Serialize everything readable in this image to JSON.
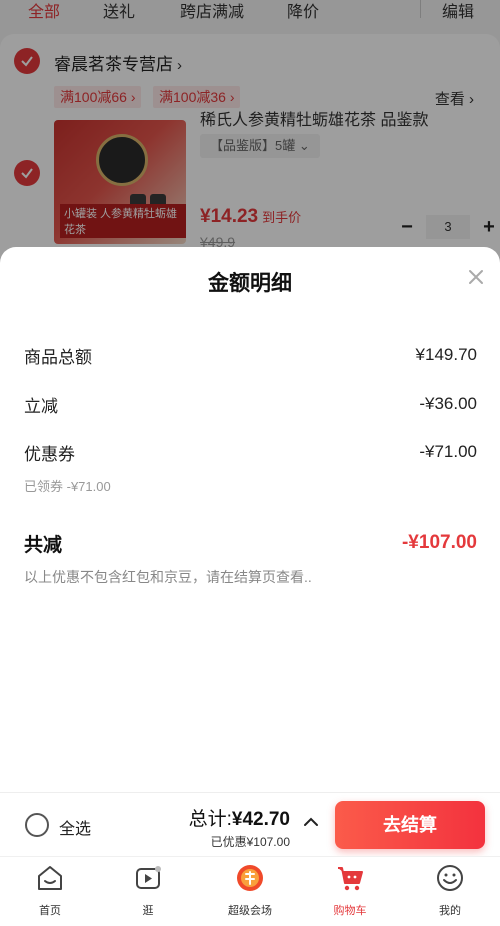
{
  "tabs": [
    {
      "label": "全部",
      "active": true
    },
    {
      "label": "送礼",
      "active": false
    },
    {
      "label": "跨店满减",
      "active": false
    },
    {
      "label": "降价",
      "active": false
    },
    {
      "label": "编辑",
      "active": false
    }
  ],
  "store": {
    "name": "睿晨茗茶专营店",
    "arrow": "›",
    "promos": [
      "满100减66 ›",
      "满100减36 ›"
    ],
    "view_label": "查看 ›"
  },
  "product": {
    "title": "稀氏人参黄精牡蛎雄花茶 品鉴款",
    "image_label": "小罐装 人参黄精牡蛎雄花茶",
    "variant": "【品鉴版】5罐  ⌄",
    "price_symbol": "¥",
    "price": "14.23",
    "price_hint": "到手价",
    "old_price": "¥49.9",
    "quantity": "3",
    "minus": "−",
    "plus": "+"
  },
  "sheet": {
    "title": "金额明细",
    "rows": [
      {
        "label": "商品总额",
        "value": "¥149.70"
      },
      {
        "label": "立减",
        "value": "-¥36.00"
      },
      {
        "label": "优惠券",
        "value": "-¥71.00"
      }
    ],
    "coupon_note": "已领券 -¥71.00",
    "total": {
      "label": "共减",
      "value": "-¥107.00"
    },
    "disclaimer": "以上优惠不包含红包和京豆，请在结算页查看.."
  },
  "checkout": {
    "select_all": "全选",
    "total_prefix": "总计:",
    "total_value": "¥42.70",
    "discount_note": "已优惠¥107.00",
    "button": "去结算"
  },
  "tabbar": [
    {
      "label": "首页",
      "icon": "home-icon"
    },
    {
      "label": "逛",
      "icon": "play-icon"
    },
    {
      "label": "超级会场",
      "icon": "mega-venue-icon"
    },
    {
      "label": "购物车",
      "icon": "cart-icon",
      "active": true
    },
    {
      "label": "我的",
      "icon": "profile-icon"
    }
  ],
  "colors": {
    "accent": "#e4393c",
    "button_gradient_start": "#fb5b4a",
    "button_gradient_end": "#f3323e"
  }
}
